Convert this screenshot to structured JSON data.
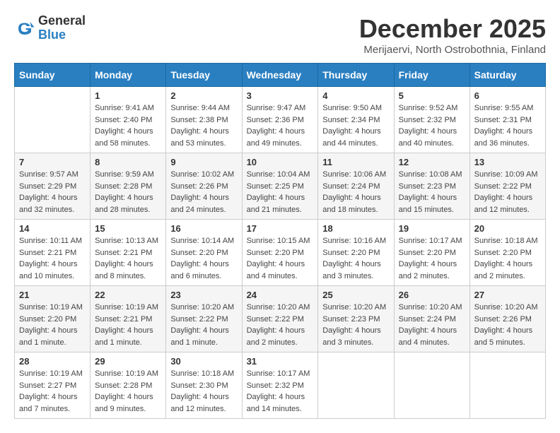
{
  "header": {
    "logo_general": "General",
    "logo_blue": "Blue",
    "month_title": "December 2025",
    "location": "Merijaervi, North Ostrobothnia, Finland"
  },
  "weekdays": [
    "Sunday",
    "Monday",
    "Tuesday",
    "Wednesday",
    "Thursday",
    "Friday",
    "Saturday"
  ],
  "weeks": [
    [
      null,
      {
        "day": "1",
        "sunrise": "Sunrise: 9:41 AM",
        "sunset": "Sunset: 2:40 PM",
        "daylight": "Daylight: 4 hours and 58 minutes."
      },
      {
        "day": "2",
        "sunrise": "Sunrise: 9:44 AM",
        "sunset": "Sunset: 2:38 PM",
        "daylight": "Daylight: 4 hours and 53 minutes."
      },
      {
        "day": "3",
        "sunrise": "Sunrise: 9:47 AM",
        "sunset": "Sunset: 2:36 PM",
        "daylight": "Daylight: 4 hours and 49 minutes."
      },
      {
        "day": "4",
        "sunrise": "Sunrise: 9:50 AM",
        "sunset": "Sunset: 2:34 PM",
        "daylight": "Daylight: 4 hours and 44 minutes."
      },
      {
        "day": "5",
        "sunrise": "Sunrise: 9:52 AM",
        "sunset": "Sunset: 2:32 PM",
        "daylight": "Daylight: 4 hours and 40 minutes."
      },
      {
        "day": "6",
        "sunrise": "Sunrise: 9:55 AM",
        "sunset": "Sunset: 2:31 PM",
        "daylight": "Daylight: 4 hours and 36 minutes."
      }
    ],
    [
      {
        "day": "7",
        "sunrise": "Sunrise: 9:57 AM",
        "sunset": "Sunset: 2:29 PM",
        "daylight": "Daylight: 4 hours and 32 minutes."
      },
      {
        "day": "8",
        "sunrise": "Sunrise: 9:59 AM",
        "sunset": "Sunset: 2:28 PM",
        "daylight": "Daylight: 4 hours and 28 minutes."
      },
      {
        "day": "9",
        "sunrise": "Sunrise: 10:02 AM",
        "sunset": "Sunset: 2:26 PM",
        "daylight": "Daylight: 4 hours and 24 minutes."
      },
      {
        "day": "10",
        "sunrise": "Sunrise: 10:04 AM",
        "sunset": "Sunset: 2:25 PM",
        "daylight": "Daylight: 4 hours and 21 minutes."
      },
      {
        "day": "11",
        "sunrise": "Sunrise: 10:06 AM",
        "sunset": "Sunset: 2:24 PM",
        "daylight": "Daylight: 4 hours and 18 minutes."
      },
      {
        "day": "12",
        "sunrise": "Sunrise: 10:08 AM",
        "sunset": "Sunset: 2:23 PM",
        "daylight": "Daylight: 4 hours and 15 minutes."
      },
      {
        "day": "13",
        "sunrise": "Sunrise: 10:09 AM",
        "sunset": "Sunset: 2:22 PM",
        "daylight": "Daylight: 4 hours and 12 minutes."
      }
    ],
    [
      {
        "day": "14",
        "sunrise": "Sunrise: 10:11 AM",
        "sunset": "Sunset: 2:21 PM",
        "daylight": "Daylight: 4 hours and 10 minutes."
      },
      {
        "day": "15",
        "sunrise": "Sunrise: 10:13 AM",
        "sunset": "Sunset: 2:21 PM",
        "daylight": "Daylight: 4 hours and 8 minutes."
      },
      {
        "day": "16",
        "sunrise": "Sunrise: 10:14 AM",
        "sunset": "Sunset: 2:20 PM",
        "daylight": "Daylight: 4 hours and 6 minutes."
      },
      {
        "day": "17",
        "sunrise": "Sunrise: 10:15 AM",
        "sunset": "Sunset: 2:20 PM",
        "daylight": "Daylight: 4 hours and 4 minutes."
      },
      {
        "day": "18",
        "sunrise": "Sunrise: 10:16 AM",
        "sunset": "Sunset: 2:20 PM",
        "daylight": "Daylight: 4 hours and 3 minutes."
      },
      {
        "day": "19",
        "sunrise": "Sunrise: 10:17 AM",
        "sunset": "Sunset: 2:20 PM",
        "daylight": "Daylight: 4 hours and 2 minutes."
      },
      {
        "day": "20",
        "sunrise": "Sunrise: 10:18 AM",
        "sunset": "Sunset: 2:20 PM",
        "daylight": "Daylight: 4 hours and 2 minutes."
      }
    ],
    [
      {
        "day": "21",
        "sunrise": "Sunrise: 10:19 AM",
        "sunset": "Sunset: 2:20 PM",
        "daylight": "Daylight: 4 hours and 1 minute."
      },
      {
        "day": "22",
        "sunrise": "Sunrise: 10:19 AM",
        "sunset": "Sunset: 2:21 PM",
        "daylight": "Daylight: 4 hours and 1 minute."
      },
      {
        "day": "23",
        "sunrise": "Sunrise: 10:20 AM",
        "sunset": "Sunset: 2:22 PM",
        "daylight": "Daylight: 4 hours and 1 minute."
      },
      {
        "day": "24",
        "sunrise": "Sunrise: 10:20 AM",
        "sunset": "Sunset: 2:22 PM",
        "daylight": "Daylight: 4 hours and 2 minutes."
      },
      {
        "day": "25",
        "sunrise": "Sunrise: 10:20 AM",
        "sunset": "Sunset: 2:23 PM",
        "daylight": "Daylight: 4 hours and 3 minutes."
      },
      {
        "day": "26",
        "sunrise": "Sunrise: 10:20 AM",
        "sunset": "Sunset: 2:24 PM",
        "daylight": "Daylight: 4 hours and 4 minutes."
      },
      {
        "day": "27",
        "sunrise": "Sunrise: 10:20 AM",
        "sunset": "Sunset: 2:26 PM",
        "daylight": "Daylight: 4 hours and 5 minutes."
      }
    ],
    [
      {
        "day": "28",
        "sunrise": "Sunrise: 10:19 AM",
        "sunset": "Sunset: 2:27 PM",
        "daylight": "Daylight: 4 hours and 7 minutes."
      },
      {
        "day": "29",
        "sunrise": "Sunrise: 10:19 AM",
        "sunset": "Sunset: 2:28 PM",
        "daylight": "Daylight: 4 hours and 9 minutes."
      },
      {
        "day": "30",
        "sunrise": "Sunrise: 10:18 AM",
        "sunset": "Sunset: 2:30 PM",
        "daylight": "Daylight: 4 hours and 12 minutes."
      },
      {
        "day": "31",
        "sunrise": "Sunrise: 10:17 AM",
        "sunset": "Sunset: 2:32 PM",
        "daylight": "Daylight: 4 hours and 14 minutes."
      },
      null,
      null,
      null
    ]
  ]
}
